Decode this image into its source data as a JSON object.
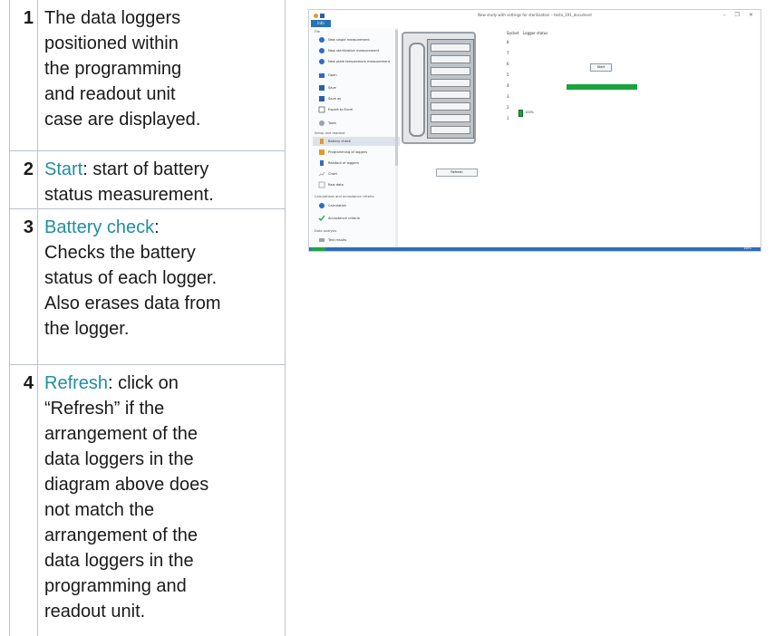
{
  "steps": [
    {
      "num": "1",
      "lines": [
        "The data loggers",
        "positioned within",
        "the programming",
        "and readout unit",
        "case are displayed."
      ]
    },
    {
      "num": "2",
      "keyword": "Start",
      "rest": ": start of battery",
      "lines": [
        "status measurement."
      ]
    },
    {
      "num": "3",
      "keyword": "Battery check",
      "rest": ":",
      "lines": [
        "Checks the battery",
        "status of each logger.",
        "Also erases data from",
        "the logger."
      ]
    },
    {
      "num": "4",
      "keyword": "Refresh",
      "rest": ": click on",
      "lines": [
        "“Refresh” if the",
        "arrangement of the",
        "data loggers in the",
        "diagram above does",
        "not match the",
        "arrangement of the",
        "data loggers in the",
        "programming and",
        "readout unit."
      ]
    }
  ],
  "app": {
    "window_title": "New study with settings for sterilization – testo_191_document",
    "info_tab": "Info",
    "window_buttons": "– ❐ ✕",
    "sidebar": {
      "sections": [
        "File",
        "Setup and readout",
        "Calculations and acceptance criteria",
        "Data analysis"
      ],
      "file_items": [
        "New single measurement",
        "New sterilization measurement",
        "New plate temperature measurement",
        "Open",
        "Save",
        "Save as",
        "Export to Excel",
        "Tools"
      ],
      "setup_items": [
        "Battery check",
        "Programming of loggers",
        "Readout of loggers",
        "Chart",
        "Raw data"
      ],
      "calc_items": [
        "Calculation",
        "Acceptance criteria"
      ],
      "data_items": [
        "Test results"
      ]
    },
    "slot_header": "Socket",
    "logger_header": "Logger status",
    "rows": [
      "8",
      "7",
      "6",
      "5",
      "4",
      "3",
      "2",
      "1"
    ],
    "start_button": "Start",
    "battery_label": "100%",
    "refresh_button": "Refresh",
    "zoom_label": "100%"
  }
}
